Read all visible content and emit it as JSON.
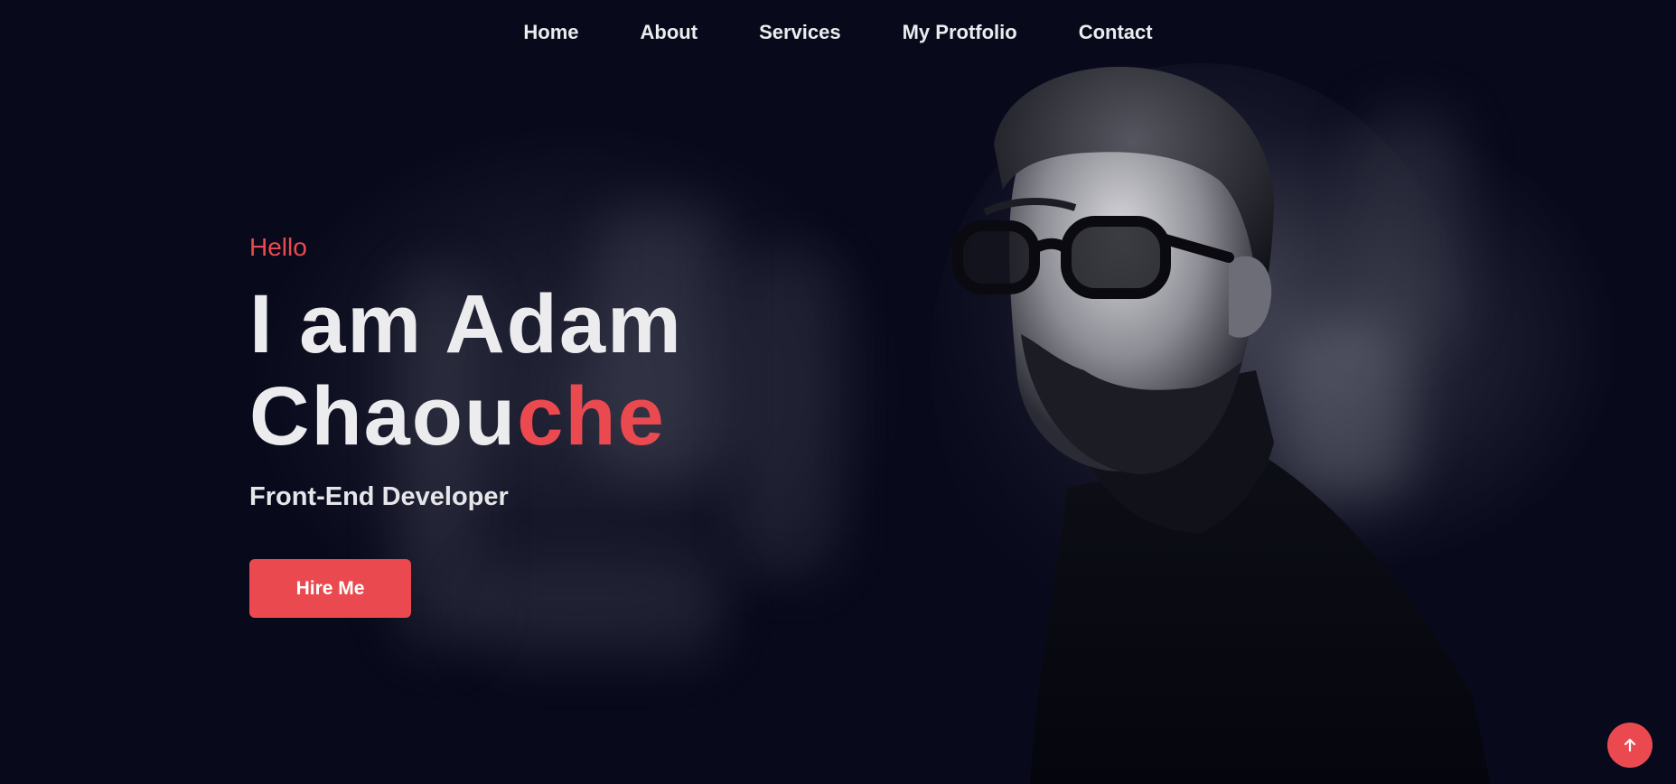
{
  "nav": {
    "items": [
      "Home",
      "About",
      "Services",
      "My Protfolio",
      "Contact"
    ]
  },
  "hero": {
    "greeting": "Hello",
    "name_line1": "I am Adam",
    "name_line2_plain": "Chaou",
    "name_line2_accent": "che",
    "role": "Front-End Developer",
    "cta_label": "Hire Me"
  },
  "icons": {
    "back_to_top": "arrow-up-icon"
  },
  "colors": {
    "background": "#080a1c",
    "accent": "#ea4a4f",
    "text": "#ececee"
  }
}
